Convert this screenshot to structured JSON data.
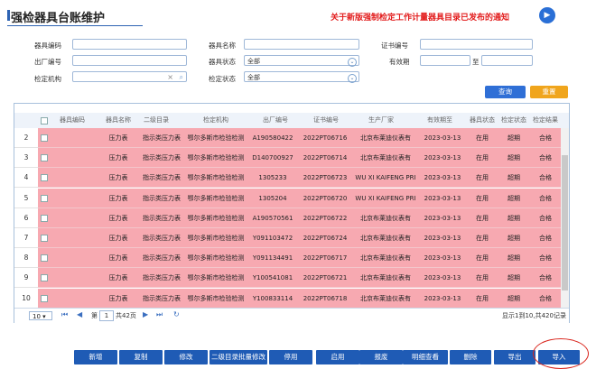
{
  "header": {
    "title": "强检器具台账维护",
    "notice": "关于新版强制检定工作计量器具目录已发布的通知",
    "notice_icon": "arrow-right-circle"
  },
  "filters": {
    "equip_code_label": "器具编码",
    "equip_code_value": "",
    "equip_name_label": "器具名称",
    "equip_name_value": "",
    "cert_no_label": "证书编号",
    "cert_no_value": "",
    "factory_no_label": "出厂编号",
    "factory_no_value": "",
    "equip_status_label": "器具状态",
    "equip_status_value": "全部",
    "valid_period_label": "有效期",
    "valid_from": "",
    "valid_to_sep": "至",
    "valid_to": "",
    "org_label": "检定机构",
    "org_value": "",
    "verify_status_label": "检定状态",
    "verify_status_value": "全部"
  },
  "actions": {
    "query": "查询",
    "reset": "重置",
    "query_color": "#2f6fd6",
    "reset_color": "#f0a51c"
  },
  "table": {
    "columns": [
      "器具编码",
      "器具名称",
      "二级目录",
      "检定机构",
      "出厂编号",
      "证书编号",
      "生产厂家",
      "有效期至",
      "器具状态",
      "检定状态",
      "检定结果"
    ],
    "rows": [
      {
        "no": "2",
        "name": "压力表",
        "dir": "指示类压力表",
        "org": "鄂尔多斯市检验检测",
        "factory": "A190580422",
        "cert": "2022PT06716",
        "maker": "北京布莱迪仪表有",
        "valid": "2023-03-13",
        "status": "在用",
        "vstatus": "超期",
        "result": "合格"
      },
      {
        "no": "3",
        "name": "压力表",
        "dir": "指示类压力表",
        "org": "鄂尔多斯市检验检测",
        "factory": "D140700927",
        "cert": "2022PT06714",
        "maker": "北京布莱迪仪表有",
        "valid": "2023-03-13",
        "status": "在用",
        "vstatus": "超期",
        "result": "合格"
      },
      {
        "no": "4",
        "name": "压力表",
        "dir": "指示类压力表",
        "org": "鄂尔多斯市检验检测",
        "factory": "1305233",
        "cert": "2022PT06723",
        "maker": "WU XI KAIFENG PRI",
        "valid": "2023-03-13",
        "status": "在用",
        "vstatus": "超期",
        "result": "合格"
      },
      {
        "no": "5",
        "name": "压力表",
        "dir": "指示类压力表",
        "org": "鄂尔多斯市检验检测",
        "factory": "1305204",
        "cert": "2022PT06720",
        "maker": "WU XI KAIFENG PRI",
        "valid": "2023-03-13",
        "status": "在用",
        "vstatus": "超期",
        "result": "合格"
      },
      {
        "no": "6",
        "name": "压力表",
        "dir": "指示类压力表",
        "org": "鄂尔多斯市检验检测",
        "factory": "A190570561",
        "cert": "2022PT06722",
        "maker": "北京布莱迪仪表有",
        "valid": "2023-03-13",
        "status": "在用",
        "vstatus": "超期",
        "result": "合格"
      },
      {
        "no": "7",
        "name": "压力表",
        "dir": "指示类压力表",
        "org": "鄂尔多斯市检验检测",
        "factory": "Y091103472",
        "cert": "2022PT06724",
        "maker": "北京布莱迪仪表有",
        "valid": "2023-03-13",
        "status": "在用",
        "vstatus": "超期",
        "result": "合格"
      },
      {
        "no": "8",
        "name": "压力表",
        "dir": "指示类压力表",
        "org": "鄂尔多斯市检验检测",
        "factory": "Y091134491",
        "cert": "2022PT06717",
        "maker": "北京布莱迪仪表有",
        "valid": "2023-03-13",
        "status": "在用",
        "vstatus": "超期",
        "result": "合格"
      },
      {
        "no": "9",
        "name": "压力表",
        "dir": "指示类压力表",
        "org": "鄂尔多斯市检验检测",
        "factory": "Y100541081",
        "cert": "2022PT06721",
        "maker": "北京布莱迪仪表有",
        "valid": "2023-03-13",
        "status": "在用",
        "vstatus": "超期",
        "result": "合格"
      },
      {
        "no": "10",
        "name": "压力表",
        "dir": "指示类压力表",
        "org": "鄂尔多斯市检验检测",
        "factory": "Y100833114",
        "cert": "2022PT06718",
        "maker": "北京布莱迪仪表有",
        "valid": "2023-03-13",
        "status": "在用",
        "vstatus": "超期",
        "result": "合格"
      }
    ],
    "row_highlight_color": "#f7a9b1"
  },
  "pager": {
    "page_size": "10",
    "page_prefix": "第",
    "page_value": "1",
    "page_suffix": "共42页",
    "summary": "显示1到10,共420记录"
  },
  "bottom_buttons": [
    "新增",
    "复制",
    "修改",
    "二级目录批量修改",
    "停用",
    "启用",
    "报废",
    "明细查看",
    "删除",
    "导出",
    "导入"
  ]
}
